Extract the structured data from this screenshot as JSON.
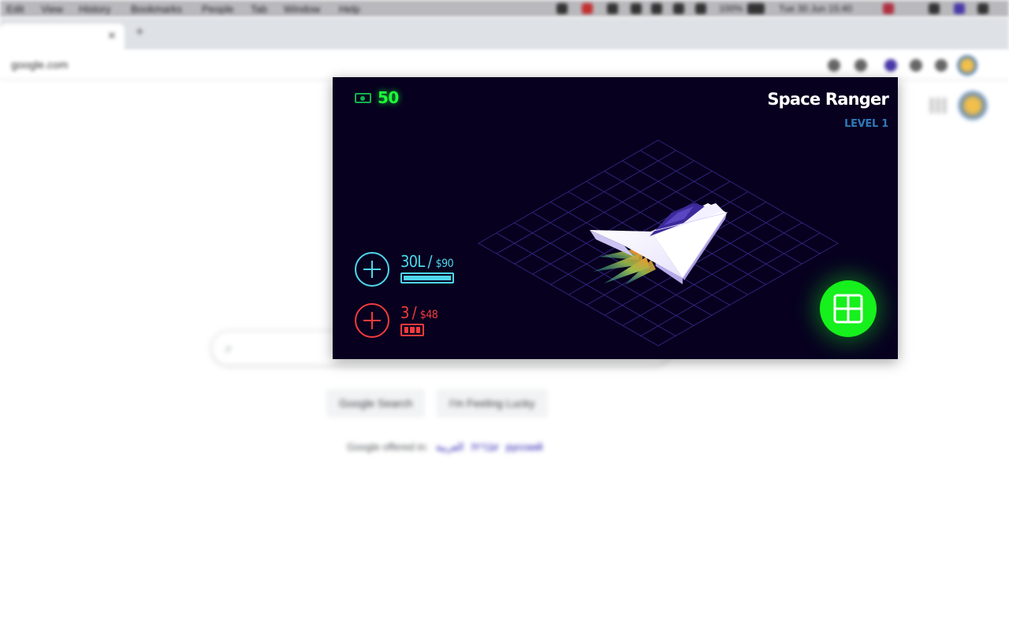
{
  "browser": {
    "menu_items": [
      "Edit",
      "View",
      "History",
      "Bookmarks",
      "People",
      "Tab",
      "Window",
      "Help"
    ],
    "clock": "Tue 30 Jun  15:40",
    "battery": "100%",
    "url": "google.com"
  },
  "google": {
    "search_button": "Google Search",
    "lucky_button": "I'm Feeling Lucky",
    "offered_in_label": "Google offered in:",
    "languages": [
      "עברית",
      "العربية",
      "русский"
    ]
  },
  "game": {
    "money": "50",
    "title": "Space Ranger",
    "level": "LEVEL 1",
    "fuel": {
      "amount": "30L",
      "separator": "/",
      "price": "$90",
      "level": 1.0,
      "color": "#4fd6ee"
    },
    "ammo": {
      "amount": "3",
      "separator": "/",
      "price": "$48",
      "count": 3,
      "color": "#f23b3b"
    },
    "accent": "#1cff3a",
    "icons": {
      "money": "cash-icon",
      "fuel_add": "plus-icon",
      "ammo_add": "plus-icon",
      "menu": "grid-icon"
    }
  }
}
